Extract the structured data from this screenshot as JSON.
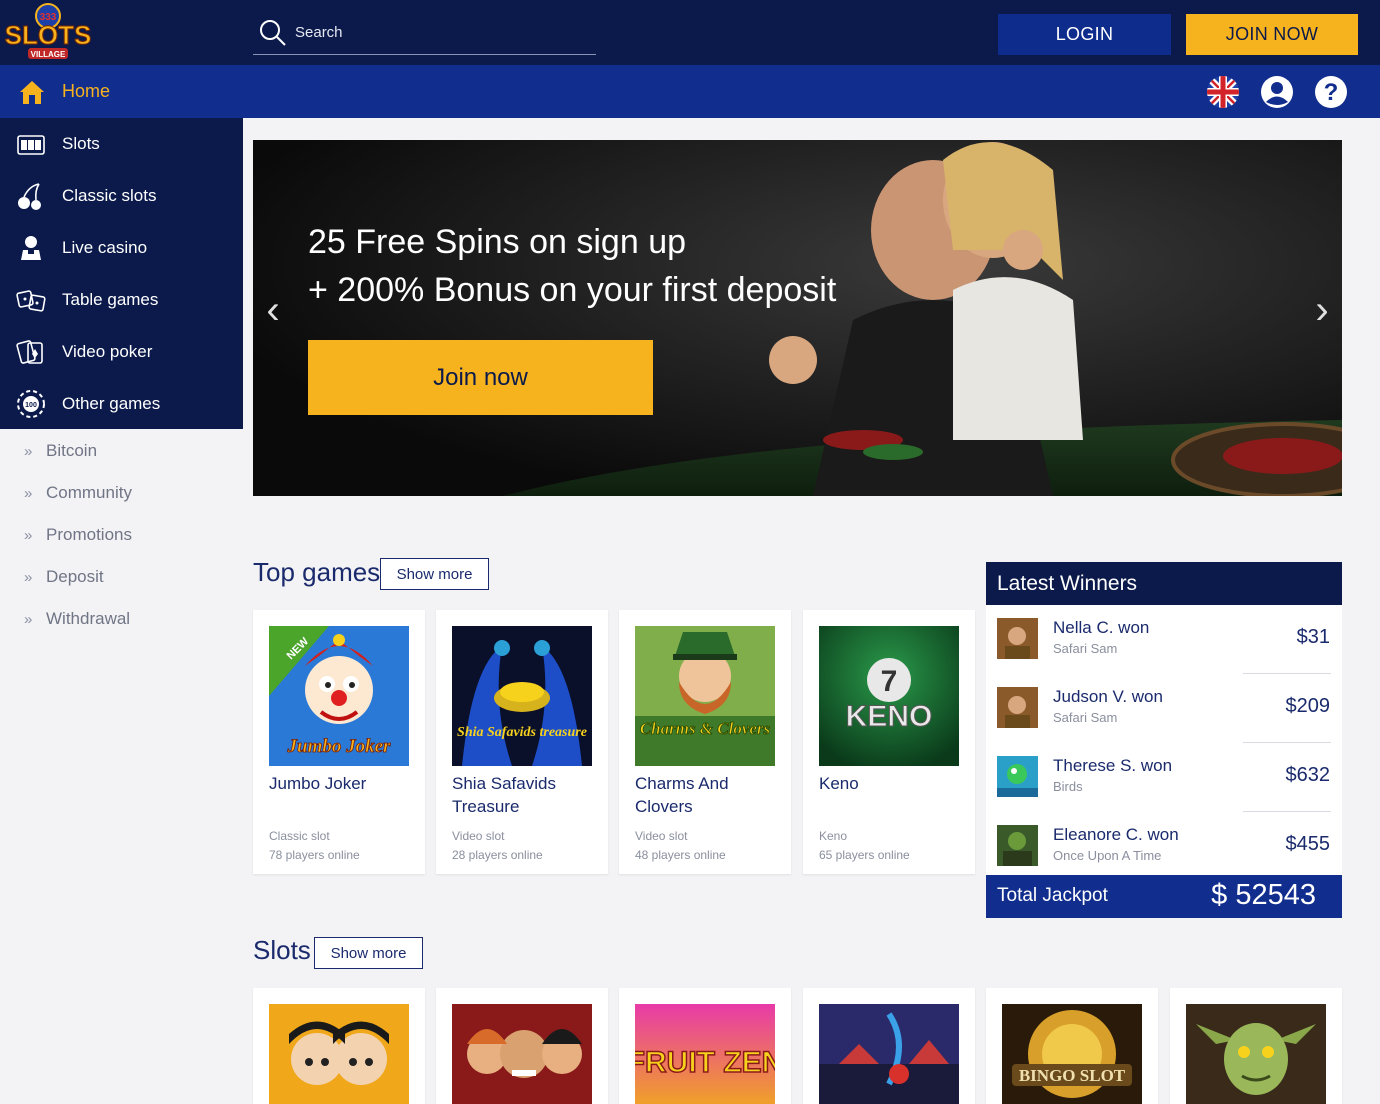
{
  "header": {
    "logo_text": "SLOTS",
    "logo_sub": "VILLAGE",
    "search_placeholder": "Search",
    "login_label": "LOGIN",
    "join_label": "JOIN NOW"
  },
  "nav": {
    "home_label": "Home",
    "icons": [
      "uk-flag-icon",
      "user-account-icon",
      "help-icon"
    ]
  },
  "sidebar": {
    "items": [
      {
        "label": "Slots",
        "icon": "slot-machine-icon"
      },
      {
        "label": "Classic slots",
        "icon": "cherries-icon"
      },
      {
        "label": "Live casino",
        "icon": "dealer-icon"
      },
      {
        "label": "Table games",
        "icon": "dice-icon"
      },
      {
        "label": "Video poker",
        "icon": "cards-icon"
      },
      {
        "label": "Other games",
        "icon": "chip-icon"
      }
    ],
    "sub_items": [
      "Bitcoin",
      "Community",
      "Promotions",
      "Deposit",
      "Withdrawal"
    ]
  },
  "banner": {
    "line1": "25 Free Spins on sign up",
    "line2": "+ 200% Bonus on your first deposit",
    "cta": "Join now"
  },
  "top_games": {
    "title": "Top games",
    "show_more": "Show more",
    "games": [
      {
        "name": "Jumbo Joker",
        "category": "Classic slot",
        "players": "78 players online",
        "badge": "NEW",
        "thumb_text": "Jumbo Joker"
      },
      {
        "name": "Shia Safavids Treasure",
        "category": "Video slot",
        "players": "28 players online",
        "thumb_text": "Shia Safavids treasure"
      },
      {
        "name": "Charms And Clovers",
        "category": "Video slot",
        "players": "48 players online",
        "thumb_text": "Charms & Clovers"
      },
      {
        "name": "Keno",
        "category": "Keno",
        "players": "65 players online",
        "thumb_text": "KENO"
      }
    ]
  },
  "winners": {
    "title": "Latest Winners",
    "rows": [
      {
        "who": "Nella C. won",
        "game": "Safari Sam",
        "amount": "$31"
      },
      {
        "who": "Judson V. won",
        "game": "Safari Sam",
        "amount": "$209"
      },
      {
        "who": "Therese S. won",
        "game": "Birds",
        "amount": "$632"
      },
      {
        "who": "Eleanore C. won",
        "game": "Once Upon A Time",
        "amount": "$455"
      }
    ],
    "jackpot_label": "Total Jackpot",
    "jackpot_value": "$ 52543"
  },
  "slots": {
    "title": "Slots",
    "show_more": "Show more",
    "thumbs": [
      "",
      "",
      "FRUIT ZEN",
      "",
      "BINGO SLOT",
      ""
    ]
  },
  "colors": {
    "navy": "#0b1a4b",
    "blue": "#112d8e",
    "gold": "#f7b31d"
  }
}
